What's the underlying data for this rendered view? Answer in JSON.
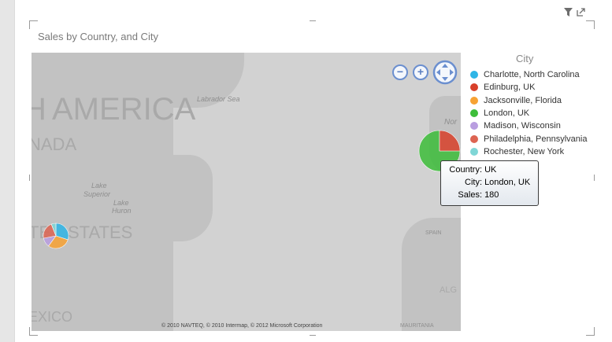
{
  "visual": {
    "title": "Sales by Country, and City",
    "icons": [
      "filter-icon",
      "expand-icon"
    ]
  },
  "map": {
    "labels": {
      "america": "AMERICA",
      "america_h": "H",
      "ada": "NADA",
      "states": "STATES",
      "tes": "TE",
      "mexico": "EXICO",
      "labrador": "Labrador Sea",
      "lake_sup": "Lake",
      "superior": "Superior",
      "lake_hur": "Lake",
      "huron": "Huron",
      "nor": "Nor",
      "spain": "SPAIN",
      "alg": "ALG",
      "mau": "MAURITANIA"
    },
    "copyright": "© 2010 NAVTEQ, © 2010 Intermap, © 2012 Microsoft Corporation",
    "controls": {
      "zoom_out": "−",
      "zoom_in": "+"
    }
  },
  "legend": {
    "title": "City",
    "items": [
      {
        "label": "Charlotte, North Carolina",
        "color": "#2fb5e6"
      },
      {
        "label": "Edinburg, UK",
        "color": "#d8402a"
      },
      {
        "label": "Jacksonville, Florida",
        "color": "#f7a233"
      },
      {
        "label": "London, UK",
        "color": "#3dbd3a"
      },
      {
        "label": "Madison, Wisconsin",
        "color": "#b99ee0"
      },
      {
        "label": "Philadelphia, Pennsylvania",
        "color": "#dd6452"
      },
      {
        "label": "Rochester, New York",
        "color": "#7fd6d6"
      }
    ]
  },
  "tooltip": {
    "country_key": "Country:",
    "country_val": "UK",
    "city_key": "City:",
    "city_val": "London, UK",
    "sales_key": "Sales:",
    "sales_val": "180"
  },
  "chart_data": {
    "type": "pie",
    "title": "Sales by Country, and City",
    "pies": [
      {
        "location": "United States",
        "slices": [
          {
            "name": "Charlotte, North Carolina",
            "value": 30
          },
          {
            "name": "Jacksonville, Florida",
            "value": 30
          },
          {
            "name": "Madison, Wisconsin",
            "value": 12
          },
          {
            "name": "Philadelphia, Pennsylvania",
            "value": 22
          },
          {
            "name": "Rochester, New York",
            "value": 6
          }
        ]
      },
      {
        "location": "UK",
        "slices": [
          {
            "name": "London, UK",
            "value": 180
          },
          {
            "name": "Edinburg, UK",
            "value": 60
          }
        ]
      }
    ]
  }
}
